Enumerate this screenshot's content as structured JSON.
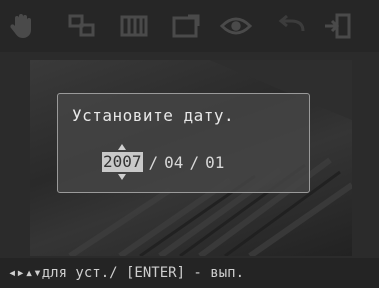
{
  "toolbar": {
    "icons": [
      "hand-icon",
      "crop-icon",
      "filter-icon",
      "frame-icon",
      "eye-icon",
      "undo-icon",
      "exit-icon"
    ]
  },
  "dialog": {
    "title": "Установите дату.",
    "year": "2007",
    "separator": "/",
    "month": "04",
    "day": "01"
  },
  "status": {
    "text": "◂▸▴▾для уст./ [ENTER] - вып."
  }
}
